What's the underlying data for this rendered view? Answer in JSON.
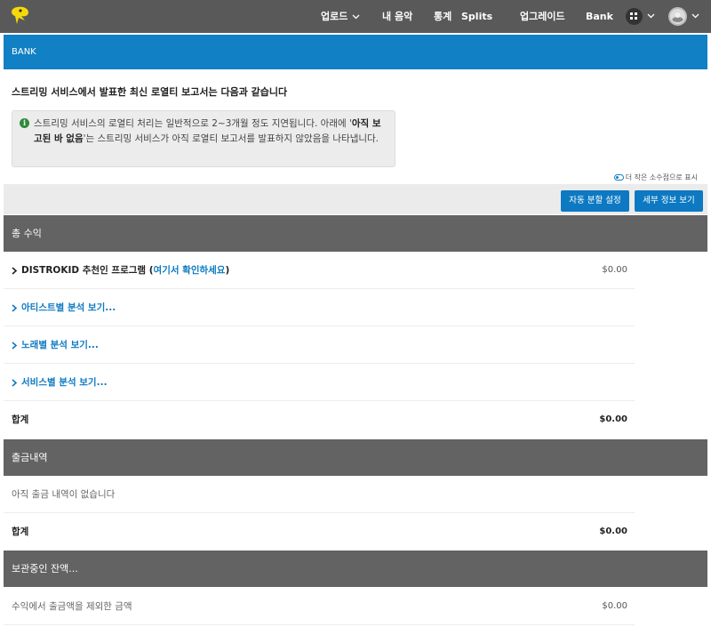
{
  "nav": {
    "upload": "업로드",
    "my_music": "내 음악",
    "stats": "통계",
    "splits": "Splits",
    "upgrade": "업그레이드",
    "bank": "Bank"
  },
  "bank_bar": {
    "title": "BANK"
  },
  "heading": "스트리밍 서비스에서 발표한 최신 로열티 보고서는 다음과 같습니다",
  "info": {
    "part1": "스트리밍 서비스의 로열티 처리는 일반적으로 2~3개월 정도 지연됩니다. 아래에 '",
    "bold": "아직 보고된 바 없음",
    "part2": "'는 스트리밍 서비스가 아직 로열티 보고서를 발표하지 않았음을 나타냅니다."
  },
  "decimals_toggle": "더 작은 소수점으로 표시",
  "buttons": {
    "auto_split": "자동 분할 설정",
    "details": "세부 정보 보기"
  },
  "total_earnings": {
    "header": "총 수익",
    "referral_label": "DISTROKID 추천인 프로그램",
    "referral_link": "여기서 확인하세요",
    "referral_value": "$0.00",
    "by_artist": "아티스트별 분석 보기...",
    "by_song": "노래별 분석 보기...",
    "by_service": "서비스별 분석 보기...",
    "total_label": "합계",
    "total_value": "$0.00"
  },
  "withdrawals": {
    "header": "출금내역",
    "empty": "아직 출금 내역이 없습니다",
    "total_label": "합계",
    "total_value": "$0.00"
  },
  "balance": {
    "header": "보관중인 잔액...",
    "label": "수익에서 출금액을 제외한 금액",
    "value": "$0.00"
  },
  "colors": {
    "nav": "#595959",
    "accent": "#1280c4",
    "section": "#636363",
    "info_icon": "#2e8b3a"
  },
  "icons": [
    "logo-icon",
    "chevron-down-icon",
    "apps-grid-icon",
    "avatar",
    "info-icon",
    "toggle-icon",
    "chevron-right-icon"
  ]
}
